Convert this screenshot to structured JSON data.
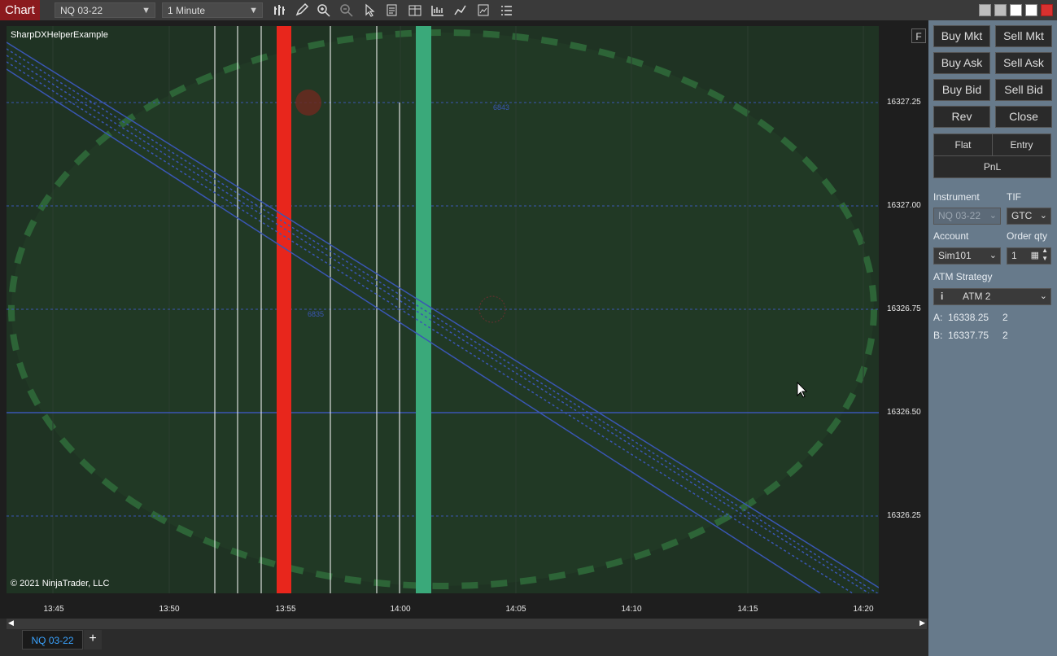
{
  "topbar": {
    "title": "Chart",
    "instrument": "NQ 03-22",
    "interval": "1 Minute",
    "tools": [
      "bar-chart-icon",
      "pencil-icon",
      "zoom-in-icon",
      "zoom-out-icon",
      "pointer-icon",
      "properties-icon",
      "columns-icon",
      "chart-trader-icon",
      "strategy-icon",
      "data-box-icon",
      "list-icon"
    ]
  },
  "chart": {
    "indicator_name": "SharpDXHelperExample",
    "copyright": "© 2021 NinjaTrader, LLC",
    "f_label": "F",
    "price_labels": [
      "16327.25",
      "16327.00",
      "16326.75",
      "16326.50",
      "16326.25"
    ],
    "time_labels": [
      "13:45",
      "13:50",
      "13:55",
      "14:00",
      "14:05",
      "14:10",
      "14:15",
      "14:20"
    ],
    "text_markers": [
      "6843",
      "6835"
    ],
    "colors": {
      "red_bar": "#e8261c",
      "green_bar": "#3aa97a",
      "channel": "#3a56b4",
      "background": "#1f3323"
    }
  },
  "tabs": {
    "active": "NQ 03-22",
    "add": "+"
  },
  "panel": {
    "buttons": {
      "buy_mkt": "Buy Mkt",
      "sell_mkt": "Sell Mkt",
      "buy_ask": "Buy Ask",
      "sell_ask": "Sell Ask",
      "buy_bid": "Buy Bid",
      "sell_bid": "Sell Bid",
      "rev": "Rev",
      "close": "Close"
    },
    "position": {
      "flat": "Flat",
      "entry": "Entry",
      "pnl": "PnL"
    },
    "instrument_label": "Instrument",
    "instrument_value": "NQ 03-22",
    "tif_label": "TIF",
    "tif_value": "GTC",
    "account_label": "Account",
    "account_value": "Sim101",
    "qty_label": "Order qty",
    "qty_value": "1",
    "atm_label": "ATM Strategy",
    "atm_value": "ATM 2",
    "ask_label": "A:",
    "ask_price": "16338.25",
    "ask_size": "2",
    "bid_label": "B:",
    "bid_price": "16337.75",
    "bid_size": "2"
  }
}
